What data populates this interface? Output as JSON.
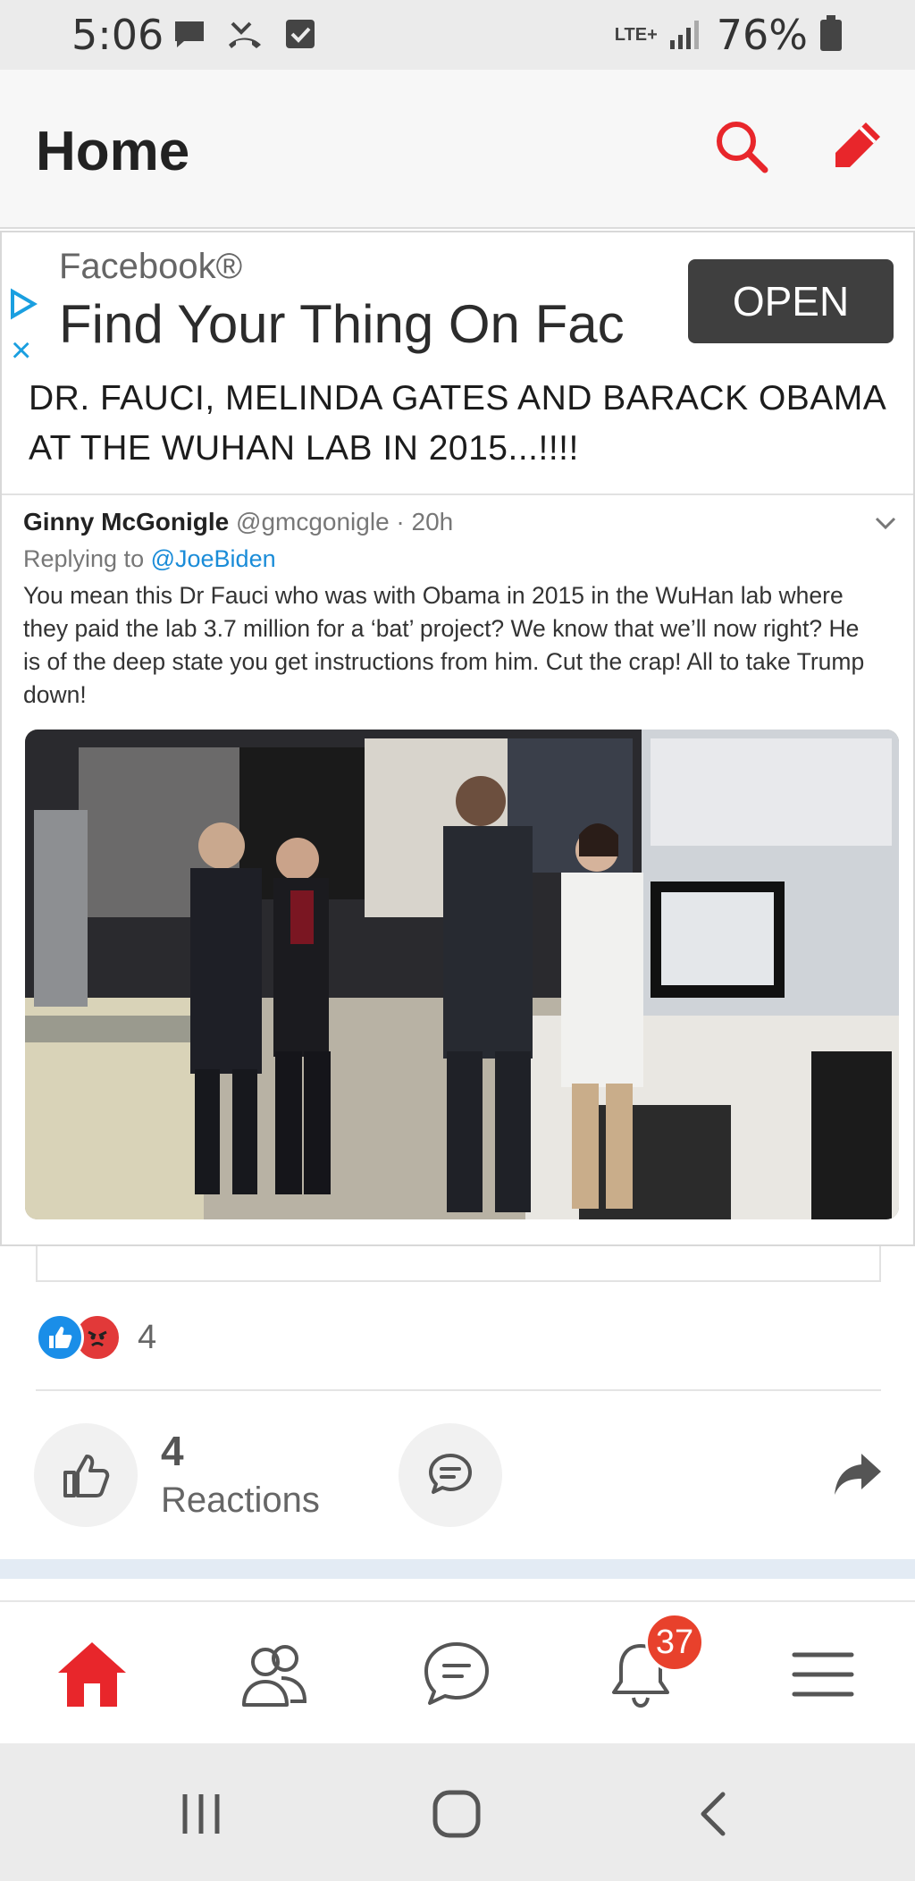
{
  "status_bar": {
    "time": "5:06",
    "network": "LTE+",
    "battery": "76%",
    "icons": [
      "message-icon",
      "missed-call-icon",
      "checkbox-icon",
      "signal-icon",
      "battery-icon"
    ]
  },
  "header": {
    "title": "Home",
    "search_icon": "search-icon",
    "compose_icon": "pencil-icon",
    "accent_color": "#e8262b"
  },
  "ad": {
    "brand": "Facebook®",
    "headline": "Find Your Thing On Fac",
    "button_label": "OPEN",
    "close_glyph": "×"
  },
  "post": {
    "caption": "DR. FAUCI, MELINDA GATES AND BARACK OBAMA AT THE WUHAN LAB IN 2015...!!!!",
    "tweet": {
      "name": "Ginny McGonigle",
      "handle": "@gmcgonigle",
      "time": "· 20h",
      "replying_prefix": "Replying to",
      "replying_to": "@JoeBiden",
      "text": "You mean this Dr Fauci who was with Obama in 2015 in the WuHan lab where they paid the lab 3.7 million for a ‘bat’ project? We know that we’ll now right? He is of the deep state you get instructions from him. Cut the crap! All to take Trump down!"
    }
  },
  "reactions": {
    "summary_count": "4",
    "count": "4",
    "label": "Reactions",
    "like_color": "#1a8ee8",
    "angry_color": "#e23939"
  },
  "bottom_nav": {
    "notification_badge": "37",
    "items": [
      "home-icon",
      "groups-icon",
      "chat-icon",
      "bell-icon",
      "menu-icon"
    ]
  },
  "system_nav": {
    "items": [
      "recents-icon",
      "home-circle-icon",
      "back-icon"
    ]
  }
}
